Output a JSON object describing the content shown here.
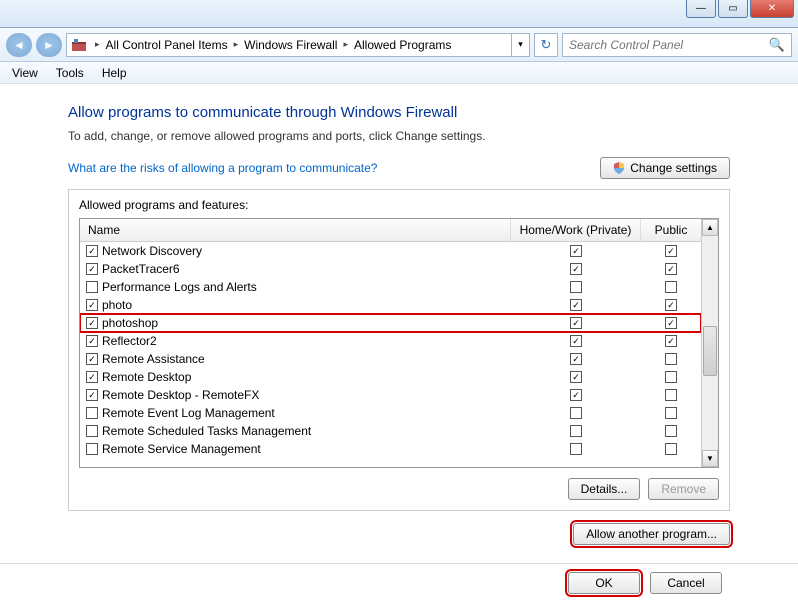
{
  "window": {
    "min": "—",
    "max": "▭",
    "close": "✕"
  },
  "breadcrumb": {
    "items": [
      "All Control Panel Items",
      "Windows Firewall",
      "Allowed Programs"
    ]
  },
  "search": {
    "placeholder": "Search Control Panel"
  },
  "menu": {
    "view": "View",
    "tools": "Tools",
    "help": "Help"
  },
  "page": {
    "heading": "Allow programs to communicate through Windows Firewall",
    "subtext": "To add, change, or remove allowed programs and ports, click Change settings.",
    "risks_link": "What are the risks of allowing a program to communicate?",
    "change_settings": "Change settings",
    "panel_label": "Allowed programs and features:",
    "col_name": "Name",
    "col_hw": "Home/Work (Private)",
    "col_pub": "Public",
    "details": "Details...",
    "remove": "Remove",
    "allow_another": "Allow another program...",
    "ok": "OK",
    "cancel": "Cancel"
  },
  "rows": [
    {
      "name": "Network Discovery",
      "enabled": true,
      "hw": true,
      "pub": true,
      "highlight": false
    },
    {
      "name": "PacketTracer6",
      "enabled": true,
      "hw": true,
      "pub": true,
      "highlight": false
    },
    {
      "name": "Performance Logs and Alerts",
      "enabled": false,
      "hw": false,
      "pub": false,
      "highlight": false
    },
    {
      "name": "photo",
      "enabled": true,
      "hw": true,
      "pub": true,
      "highlight": false
    },
    {
      "name": "photoshop",
      "enabled": true,
      "hw": true,
      "pub": true,
      "highlight": true
    },
    {
      "name": "Reflector2",
      "enabled": true,
      "hw": true,
      "pub": true,
      "highlight": false
    },
    {
      "name": "Remote Assistance",
      "enabled": true,
      "hw": true,
      "pub": false,
      "highlight": false
    },
    {
      "name": "Remote Desktop",
      "enabled": true,
      "hw": true,
      "pub": false,
      "highlight": false
    },
    {
      "name": "Remote Desktop - RemoteFX",
      "enabled": true,
      "hw": true,
      "pub": false,
      "highlight": false
    },
    {
      "name": "Remote Event Log Management",
      "enabled": false,
      "hw": false,
      "pub": false,
      "highlight": false
    },
    {
      "name": "Remote Scheduled Tasks Management",
      "enabled": false,
      "hw": false,
      "pub": false,
      "highlight": false
    },
    {
      "name": "Remote Service Management",
      "enabled": false,
      "hw": false,
      "pub": false,
      "highlight": false
    }
  ]
}
